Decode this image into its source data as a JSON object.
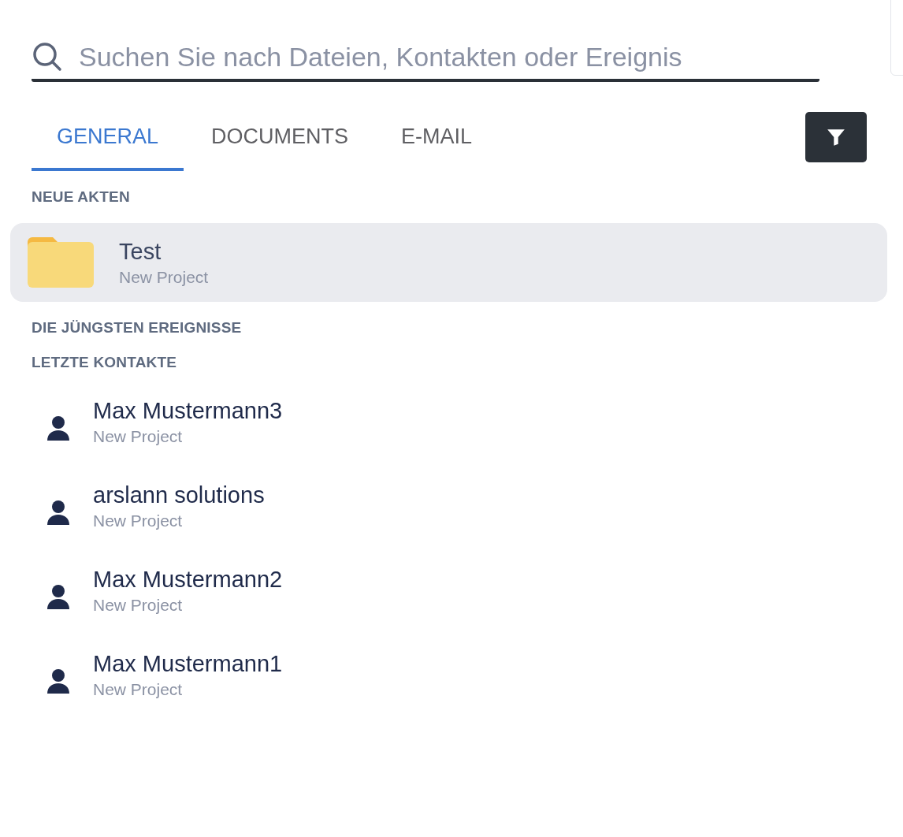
{
  "search": {
    "placeholder": "Suchen Sie nach Dateien, Kontakten oder Ereignis"
  },
  "tabs": [
    {
      "label": "GENERAL",
      "selected": true
    },
    {
      "label": "DOCUMENTS",
      "selected": false
    },
    {
      "label": "E-MAIL",
      "selected": false
    }
  ],
  "sections": [
    {
      "title": "NEUE AKTEN",
      "kind": "files",
      "items": [
        {
          "name": "Test",
          "subtitle": "New Project",
          "selected": true
        }
      ]
    },
    {
      "title": "DIE JÜNGSTEN EREIGNISSE",
      "kind": "events"
    },
    {
      "title": "LETZTE KONTAKTE",
      "kind": "contacts",
      "items": [
        {
          "name": "Max Mustermann3",
          "subtitle": "New Project"
        },
        {
          "name": "arslann solutions",
          "subtitle": "New Project"
        },
        {
          "name": "Max Mustermann2",
          "subtitle": "New Project"
        },
        {
          "name": "Max Mustermann1",
          "subtitle": "New Project"
        }
      ]
    }
  ]
}
